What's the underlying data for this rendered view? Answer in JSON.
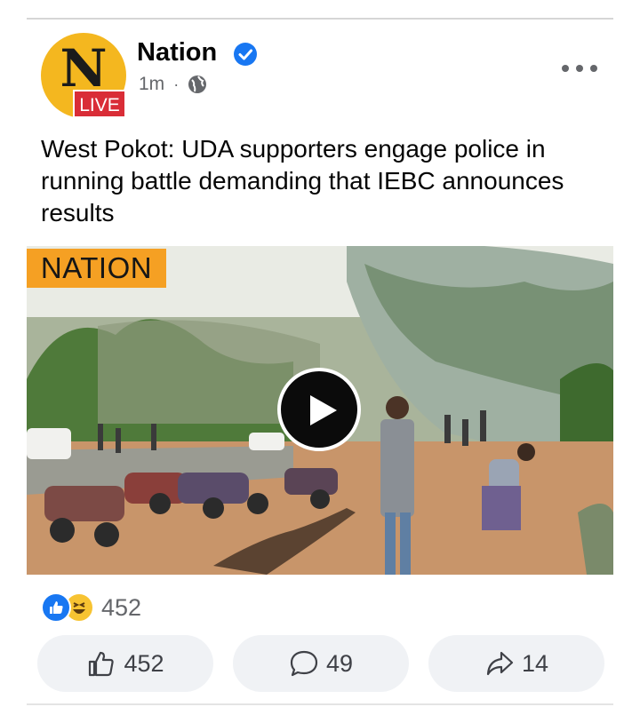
{
  "post": {
    "page_name": "Nation",
    "avatar_letter": "N",
    "avatar_badge": "LIVE",
    "time": "1m",
    "separator": "·",
    "text": "West Pokot: UDA supporters engage police in running battle demanding that IEBC announces results",
    "video_brand": "NATION",
    "reaction_count": "452",
    "like_count": "452",
    "comment_count": "49",
    "share_count": "14"
  },
  "icons": {
    "verified": "verified-check-icon",
    "privacy": "globe-icon",
    "more": "more-horizontal-icon",
    "play": "play-icon",
    "like": "thumbs-up-icon",
    "comment": "comment-bubble-icon",
    "share": "share-arrow-icon"
  },
  "colors": {
    "facebook_blue": "#1877f2",
    "avatar_yellow": "#f4b71f",
    "live_red": "#d92d37",
    "brand_orange": "#f5a023",
    "secondary_text": "#65676b",
    "button_bg": "#f0f2f5"
  }
}
